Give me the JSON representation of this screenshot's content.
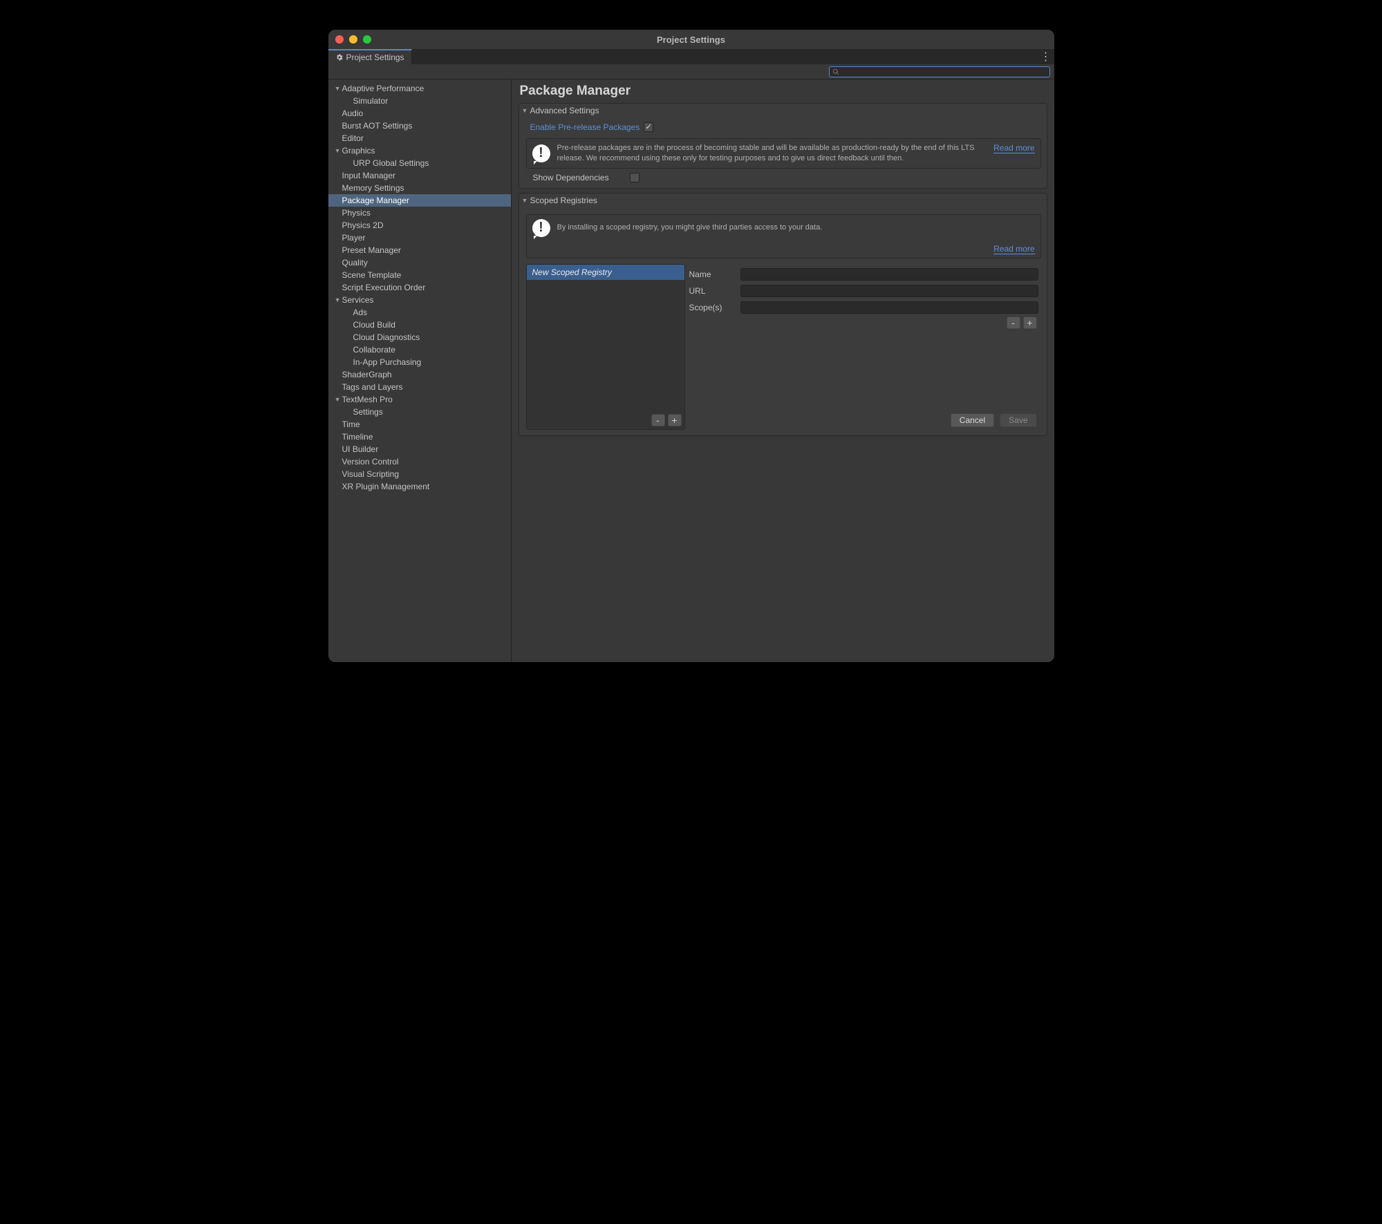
{
  "window": {
    "title": "Project Settings",
    "tab_label": "Project Settings",
    "search_value": ""
  },
  "sidebar": {
    "selected": "Package Manager",
    "items": [
      {
        "label": "Adaptive Performance",
        "level": 1,
        "expandable": true
      },
      {
        "label": "Simulator",
        "level": 2,
        "expandable": false
      },
      {
        "label": "Audio",
        "level": 1,
        "expandable": false
      },
      {
        "label": "Burst AOT Settings",
        "level": 1,
        "expandable": false
      },
      {
        "label": "Editor",
        "level": 1,
        "expandable": false
      },
      {
        "label": "Graphics",
        "level": 1,
        "expandable": true
      },
      {
        "label": "URP Global Settings",
        "level": 2,
        "expandable": false
      },
      {
        "label": "Input Manager",
        "level": 1,
        "expandable": false
      },
      {
        "label": "Memory Settings",
        "level": 1,
        "expandable": false
      },
      {
        "label": "Package Manager",
        "level": 1,
        "expandable": false
      },
      {
        "label": "Physics",
        "level": 1,
        "expandable": false
      },
      {
        "label": "Physics 2D",
        "level": 1,
        "expandable": false
      },
      {
        "label": "Player",
        "level": 1,
        "expandable": false
      },
      {
        "label": "Preset Manager",
        "level": 1,
        "expandable": false
      },
      {
        "label": "Quality",
        "level": 1,
        "expandable": false
      },
      {
        "label": "Scene Template",
        "level": 1,
        "expandable": false
      },
      {
        "label": "Script Execution Order",
        "level": 1,
        "expandable": false
      },
      {
        "label": "Services",
        "level": 1,
        "expandable": true
      },
      {
        "label": "Ads",
        "level": 2,
        "expandable": false
      },
      {
        "label": "Cloud Build",
        "level": 2,
        "expandable": false
      },
      {
        "label": "Cloud Diagnostics",
        "level": 2,
        "expandable": false
      },
      {
        "label": "Collaborate",
        "level": 2,
        "expandable": false
      },
      {
        "label": "In-App Purchasing",
        "level": 2,
        "expandable": false
      },
      {
        "label": "ShaderGraph",
        "level": 1,
        "expandable": false
      },
      {
        "label": "Tags and Layers",
        "level": 1,
        "expandable": false
      },
      {
        "label": "TextMesh Pro",
        "level": 1,
        "expandable": true
      },
      {
        "label": "Settings",
        "level": 2,
        "expandable": false
      },
      {
        "label": "Time",
        "level": 1,
        "expandable": false
      },
      {
        "label": "Timeline",
        "level": 1,
        "expandable": false
      },
      {
        "label": "UI Builder",
        "level": 1,
        "expandable": false
      },
      {
        "label": "Version Control",
        "level": 1,
        "expandable": false
      },
      {
        "label": "Visual Scripting",
        "level": 1,
        "expandable": false
      },
      {
        "label": "XR Plugin Management",
        "level": 1,
        "expandable": false
      }
    ]
  },
  "page": {
    "title": "Package Manager",
    "advanced": {
      "heading": "Advanced Settings",
      "enable_prerelease_label": "Enable Pre-release Packages",
      "enable_prerelease_checked": true,
      "prerelease_info": "Pre-release packages are in the process of becoming stable and will be available as production-ready by the end of this LTS release. We recommend using these only for testing purposes and to give us direct feedback until then.",
      "read_more": "Read more",
      "show_dependencies_label": "Show Dependencies",
      "show_dependencies_checked": false
    },
    "scoped": {
      "heading": "Scoped Registries",
      "info": "By installing a scoped registry, you might give third parties access to your data.",
      "read_more": "Read more",
      "list": [
        {
          "label": "New Scoped Registry",
          "selected": true
        }
      ],
      "detail": {
        "name_label": "Name",
        "name_value": "",
        "url_label": "URL",
        "url_value": "",
        "scopes_label": "Scope(s)",
        "scopes_value": ""
      },
      "buttons": {
        "remove": "-",
        "add": "+",
        "cancel": "Cancel",
        "save": "Save"
      }
    }
  }
}
